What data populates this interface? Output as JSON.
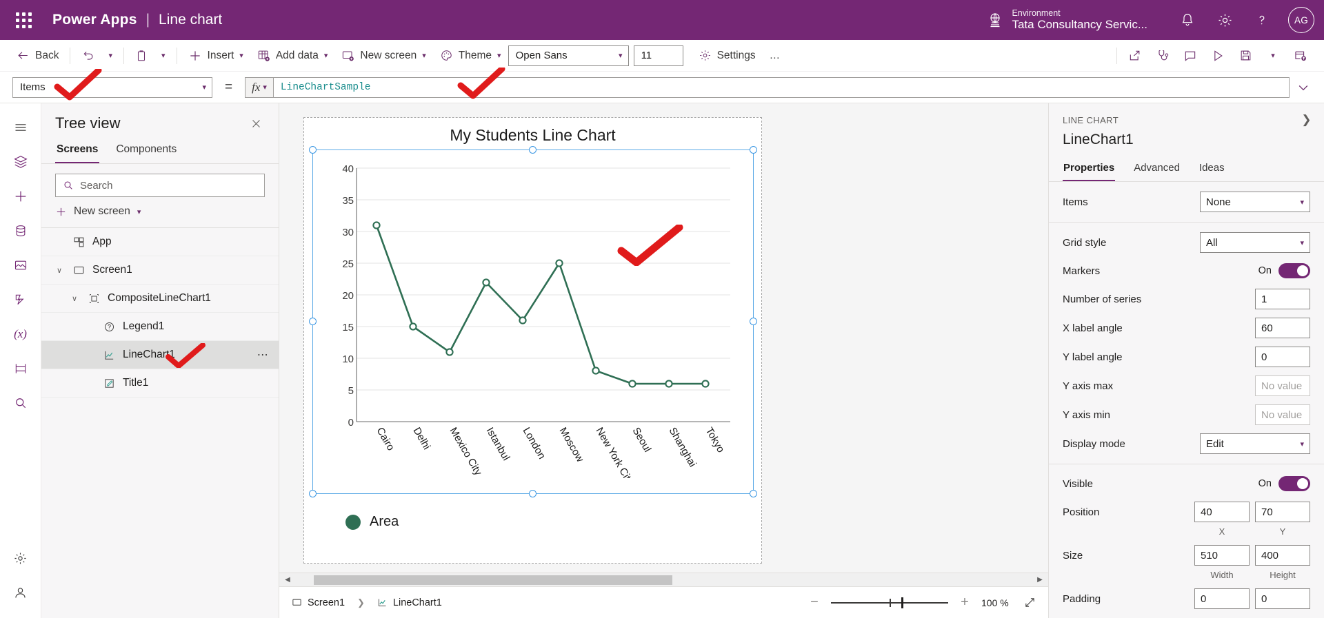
{
  "topbar": {
    "waffle_icon": "app-launcher-icon",
    "brand": "Power Apps",
    "separator": "|",
    "document_title": "Line chart",
    "environment_label": "Environment",
    "environment_value": "Tata Consultancy Servic...",
    "globe_icon": "globe-icon",
    "bell_icon": "notification-bell-icon",
    "gear_icon": "settings-gear-icon",
    "help_icon": "help-question-icon",
    "avatar_initials": "AG",
    "brand_color": "#742774"
  },
  "command_bar": {
    "back": "Back",
    "undo_icon": "undo-icon",
    "paste_icon": "paste-icon",
    "insert": "Insert",
    "add_data": "Add data",
    "new_screen": "New screen",
    "theme": "Theme",
    "font_family": "Open Sans",
    "font_size": "11",
    "settings": "Settings",
    "overflow": "…",
    "right_icons": [
      "share-icon",
      "app-checker-stethoscope-icon",
      "comments-icon",
      "preview-play-icon",
      "save-icon",
      "chevron-down-icon",
      "publish-icon"
    ]
  },
  "formula_bar": {
    "property_selected": "Items",
    "equals": "=",
    "fx_label": "fx",
    "formula": "LineChartSample",
    "formula_color": "#1a8d8d",
    "expand_icon": "chevron-down-icon"
  },
  "rail": {
    "icons": [
      "hamburger-menu-icon",
      "tree-view-layers-icon",
      "insert-plus-icon",
      "data-cylinder-icon",
      "media-icon",
      "power-automate-icon",
      "variables-fx-icon",
      "components-icon",
      "search-icon",
      "settings-gear-icon",
      "account-icon"
    ]
  },
  "tree_view": {
    "title": "Tree view",
    "close_icon": "close-icon",
    "tabs": [
      {
        "label": "Screens",
        "active": true
      },
      {
        "label": "Components",
        "active": false
      }
    ],
    "search_placeholder": "Search",
    "search_icon": "search-icon",
    "new_screen_label": "New screen",
    "nodes": [
      {
        "label": "App",
        "icon": "app-icon",
        "depth": 0,
        "caret": "",
        "selected": false,
        "dots": false
      },
      {
        "label": "Screen1",
        "icon": "screen-icon",
        "depth": 0,
        "caret": "∨",
        "selected": false,
        "dots": false
      },
      {
        "label": "CompositeLineChart1",
        "icon": "composite-chart-icon",
        "depth": 1,
        "caret": "∨",
        "selected": false,
        "dots": false
      },
      {
        "label": "Legend1",
        "icon": "legend-question-icon",
        "depth": 2,
        "caret": "",
        "selected": false,
        "dots": false
      },
      {
        "label": "LineChart1",
        "icon": "line-chart-icon",
        "depth": 2,
        "caret": "",
        "selected": true,
        "dots": true
      },
      {
        "label": "Title1",
        "icon": "title-pencil-icon",
        "depth": 2,
        "caret": "",
        "selected": false,
        "dots": false
      }
    ]
  },
  "chart_data": {
    "type": "line",
    "title": "My Students Line Chart",
    "categories": [
      "Cairo",
      "Delhi",
      "Mexico City",
      "Istanbul",
      "London",
      "Moscow",
      "New York Cit...",
      "Seoul",
      "Shanghai",
      "Tokyo"
    ],
    "values": [
      31,
      15,
      11,
      22,
      16,
      25,
      8,
      6,
      6,
      6
    ],
    "series": [
      {
        "name": "Area",
        "values": [
          31,
          15,
          11,
          22,
          16,
          25,
          8,
          6,
          6,
          6
        ],
        "color": "#2f6f54"
      }
    ],
    "xlabel": "",
    "ylabel": "",
    "ylim": [
      0,
      40
    ],
    "yticks": [
      0,
      5,
      10,
      15,
      20,
      25,
      30,
      35,
      40
    ],
    "grid": true,
    "markers": true,
    "x_label_angle": 60,
    "legend": {
      "position": "bottom-left",
      "entries": [
        "Area"
      ]
    }
  },
  "canvas": {
    "selection_handles": 6,
    "annotations": [
      "red-checkmark"
    ]
  },
  "properties_panel": {
    "kicker": "LINE CHART",
    "expand_icon": "chevron-right-icon",
    "control_name": "LineChart1",
    "tabs": [
      {
        "label": "Properties",
        "active": true
      },
      {
        "label": "Advanced",
        "active": false
      },
      {
        "label": "Ideas",
        "active": false
      }
    ],
    "groups": [
      {
        "rows": [
          {
            "label": "Items",
            "type": "select",
            "value": "None"
          }
        ]
      },
      {
        "rows": [
          {
            "label": "Grid style",
            "type": "select",
            "value": "All"
          },
          {
            "label": "Markers",
            "type": "toggle",
            "value": "On"
          },
          {
            "label": "Number of series",
            "type": "input",
            "value": "1"
          },
          {
            "label": "X label angle",
            "type": "input",
            "value": "60"
          },
          {
            "label": "Y label angle",
            "type": "input",
            "value": "0"
          },
          {
            "label": "Y axis max",
            "type": "input",
            "value": "",
            "placeholder": "No value"
          },
          {
            "label": "Y axis min",
            "type": "input",
            "value": "",
            "placeholder": "No value"
          },
          {
            "label": "Display mode",
            "type": "select",
            "value": "Edit"
          }
        ]
      },
      {
        "rows": [
          {
            "label": "Visible",
            "type": "toggle",
            "value": "On"
          },
          {
            "label": "Position",
            "type": "dual",
            "value1": "40",
            "value2": "70",
            "cap1": "X",
            "cap2": "Y"
          },
          {
            "label": "Size",
            "type": "dual",
            "value1": "510",
            "value2": "400",
            "cap1": "Width",
            "cap2": "Height"
          },
          {
            "label": "Padding",
            "type": "dual",
            "value1": "0",
            "value2": "0",
            "cap1": "",
            "cap2": ""
          }
        ]
      }
    ]
  },
  "status_bar": {
    "breadcrumb": [
      {
        "label": "Screen1",
        "icon": "screen-icon"
      },
      {
        "label": "LineChart1",
        "icon": "line-chart-icon"
      }
    ],
    "zoom_out_icon": "minus-icon",
    "zoom_in_icon": "plus-icon",
    "zoom_level": "100 %",
    "fit_icon": "fit-screen-icon"
  }
}
